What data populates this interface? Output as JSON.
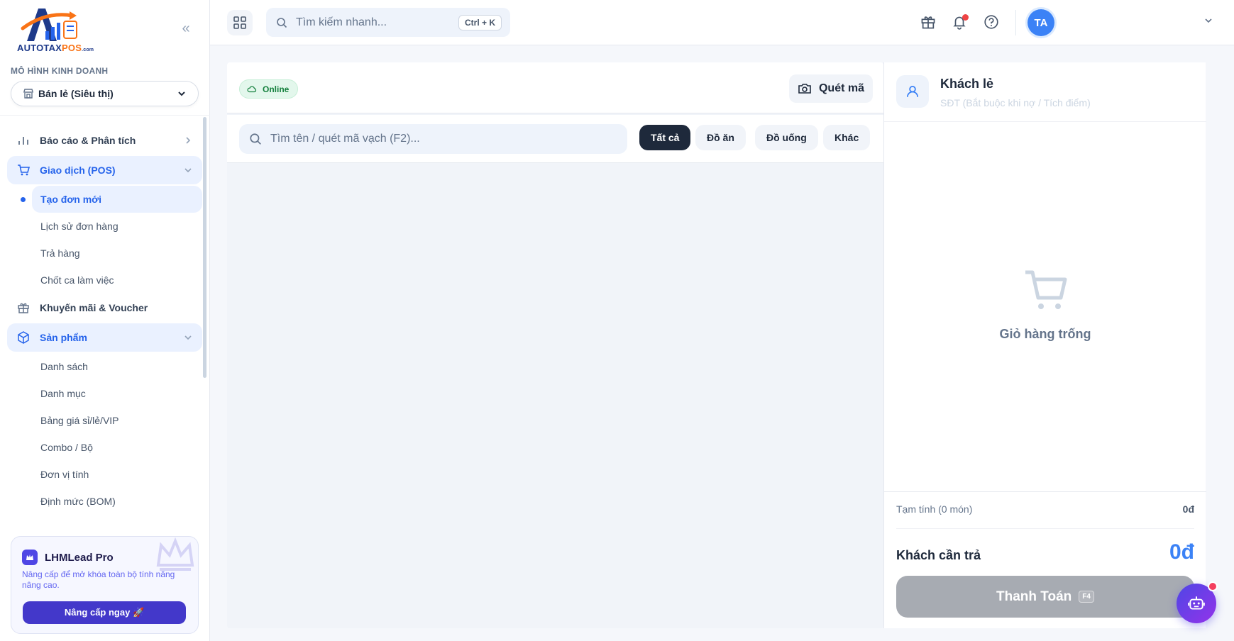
{
  "brand": {
    "logo_main": "AUTOTAX",
    "logo_accent": "POS",
    "logo_suffix": ".com"
  },
  "sidebar": {
    "section_label": "MÔ HÌNH KINH DOANH",
    "business_model": "Bán lẻ (Siêu thị)",
    "items": [
      {
        "label": "Báo cáo & Phân tích",
        "icon": "chart-bar-icon"
      },
      {
        "label": "Giao dịch (POS)",
        "icon": "cart-icon",
        "expanded": true
      },
      {
        "label": "Khuyến mãi & Voucher",
        "icon": "gift-icon"
      },
      {
        "label": "Sản phẩm",
        "icon": "box-icon",
        "expanded": true
      }
    ],
    "pos_sub": [
      "Tạo đơn mới",
      "Lịch sử đơn hàng",
      "Trả hàng",
      "Chốt ca làm việc"
    ],
    "product_sub": [
      "Danh sách",
      "Danh mục",
      "Bảng giá sỉ/lẻ/VIP",
      "Combo / Bộ",
      "Đơn vị tính",
      "Định mức (BOM)"
    ],
    "pro": {
      "title": "LHMLead Pro",
      "description": "Nâng cấp để mở khóa toàn bộ tính năng nâng cao.",
      "button": "Nâng cấp ngay 🚀"
    }
  },
  "topbar": {
    "search_placeholder": "Tìm kiếm nhanh...",
    "shortcut": "Ctrl + K",
    "avatar_initials": "TA",
    "accent": "#3b82f6"
  },
  "products": {
    "status": "Online",
    "scan_label": "Quét mã",
    "search_placeholder": "Tìm tên / quét mã vạch (F2)...",
    "filters": [
      "Tất cả",
      "Đồ ăn",
      "Đồ uống",
      "Khác"
    ],
    "active_filter": 0
  },
  "cart": {
    "customer_name": "Khách lẻ",
    "customer_hint": "SĐT (Bắt buộc khi nợ / Tích điểm)",
    "empty_text": "Giỏ hàng trống",
    "subtotal_label": "Tạm tính (0 món)",
    "subtotal_value": "0đ",
    "due_label": "Khách cần trả",
    "due_value": "0đ",
    "pay_label": "Thanh Toán",
    "pay_shortcut": "F4"
  }
}
